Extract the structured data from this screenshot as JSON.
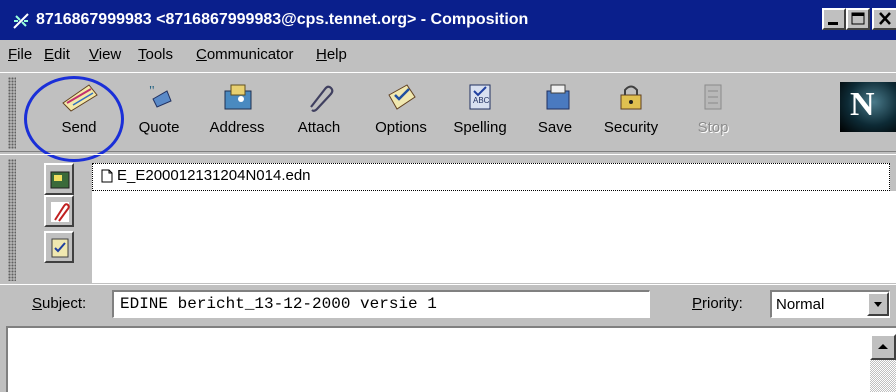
{
  "window": {
    "title": "8716867999983 <8716867999983@cps.tennet.org> - Composition"
  },
  "menu": [
    {
      "label": "File",
      "accel": "F",
      "rest": "ile"
    },
    {
      "label": "Edit",
      "accel": "E",
      "rest": "dit"
    },
    {
      "label": "View",
      "accel": "V",
      "rest": "iew"
    },
    {
      "label": "Tools",
      "accel": "T",
      "rest": "ools"
    },
    {
      "label": "Communicator",
      "accel": "C",
      "rest": "ommunicator"
    },
    {
      "label": "Help",
      "accel": "H",
      "rest": "elp"
    }
  ],
  "toolbar": {
    "send": "Send",
    "quote": "Quote",
    "address": "Address",
    "attach": "Attach",
    "options": "Options",
    "spelling": "Spelling",
    "save": "Save",
    "security": "Security",
    "stop": "Stop",
    "logo": "N"
  },
  "attachments": {
    "files": [
      "E_E200012131204N014.edn"
    ]
  },
  "subject": {
    "label_accel": "S",
    "label_rest": "ubject:",
    "value": "EDINE bericht_13-12-2000 versie 1"
  },
  "priority": {
    "label_accel": "P",
    "label_rest": "riority:",
    "value": "Normal"
  },
  "colors": {
    "titlebar": "#0a1f8c",
    "highlight": "#1a2fd8",
    "chrome": "#c0c0c0"
  }
}
